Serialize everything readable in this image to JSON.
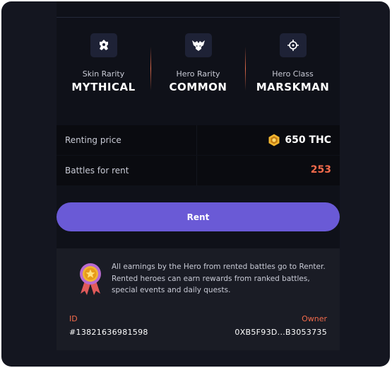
{
  "attributes": [
    {
      "label": "Skin Rarity",
      "value": "MYTHICAL",
      "icon": "skin-rarity-icon"
    },
    {
      "label": "Hero Rarity",
      "value": "COMMON",
      "icon": "hero-rarity-icon"
    },
    {
      "label": "Hero Class",
      "value": "MARSKMAN",
      "icon": "crosshair-icon"
    }
  ],
  "rental": {
    "price_label": "Renting price",
    "price_value": "650 THC",
    "battles_label": "Battles for rent",
    "battles_value": "253"
  },
  "rent_button": {
    "label": "Rent"
  },
  "info": {
    "text": "All earnings by the Hero from rented battles go to Renter. Rented heroes can earn rewards from ranked battles, special events and daily quests.",
    "id_label": "ID",
    "id_value": "#13821636981598",
    "owner_label": "Owner",
    "owner_value": "0XB5F93D...B3053735"
  },
  "colors": {
    "accent": "#6a5ad6",
    "highlight": "#f26a4b",
    "background": "#141620",
    "coin": "#f2b630"
  }
}
